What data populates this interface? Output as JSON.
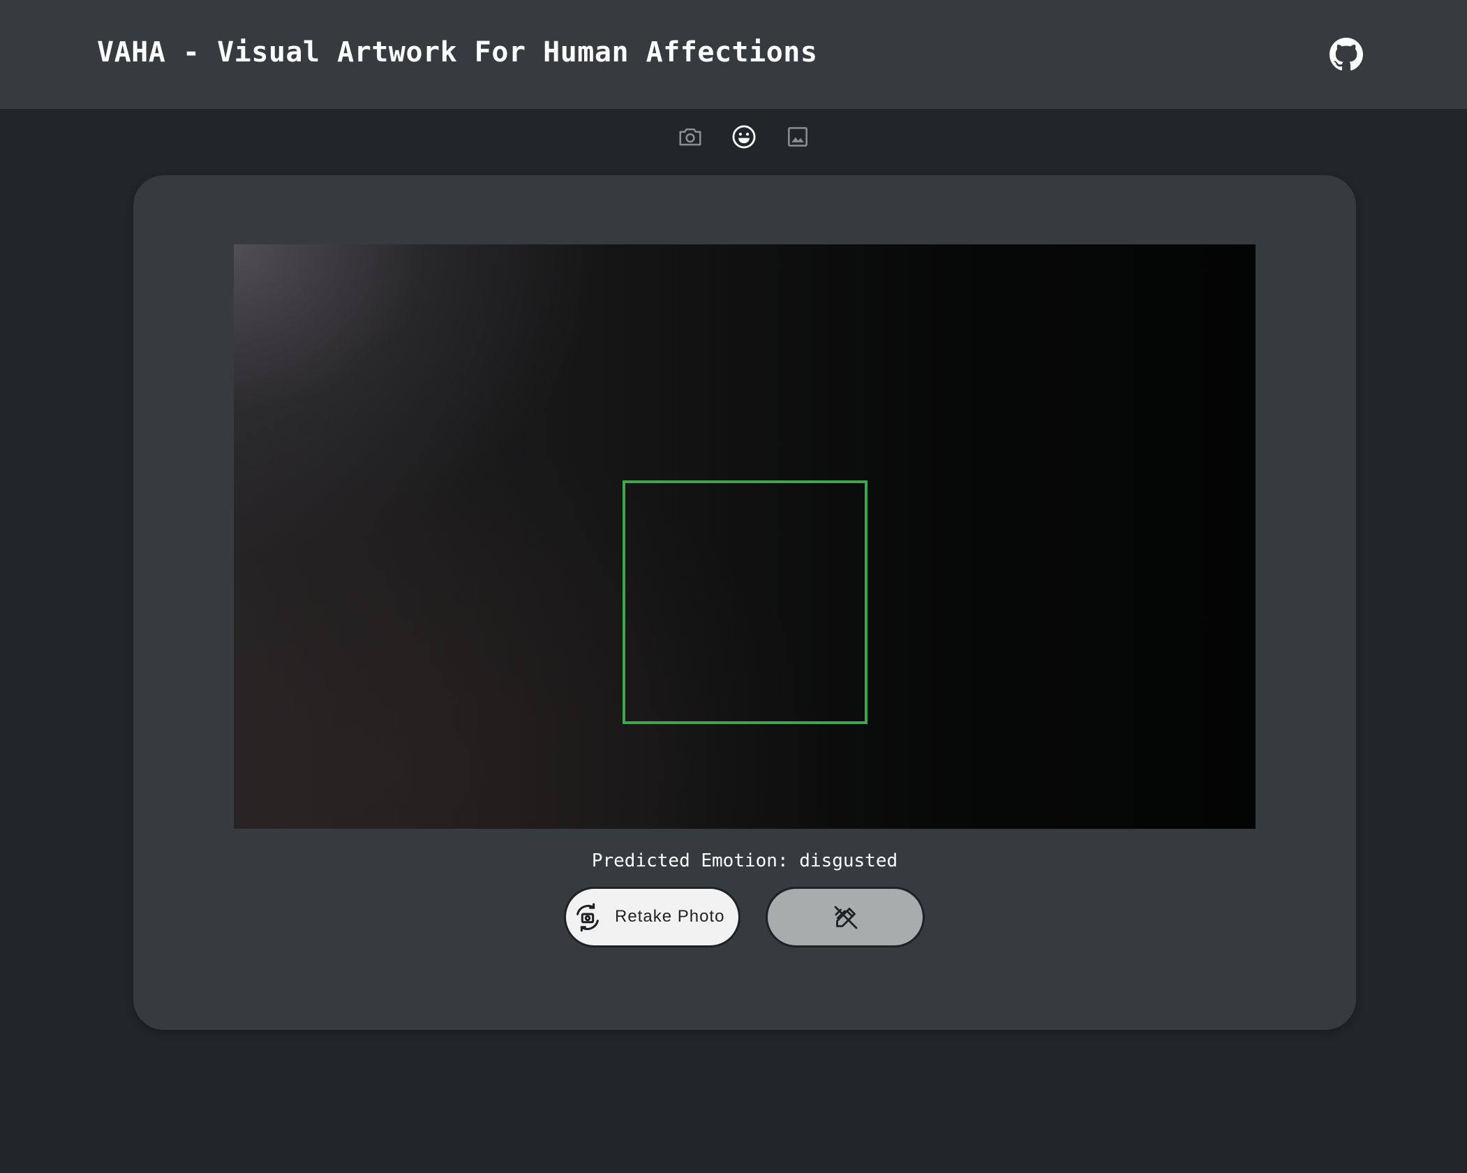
{
  "header": {
    "title": "VAHA - Visual Artwork For Human Affections",
    "github_icon": "github-icon"
  },
  "mode_tabs": [
    {
      "icon": "camera-icon",
      "active": false
    },
    {
      "icon": "smiley-face-icon",
      "active": true
    },
    {
      "icon": "image-icon",
      "active": false
    }
  ],
  "main": {
    "emotion_label": "Predicted Emotion: disgusted",
    "retake_button": {
      "label": "Retake Photo",
      "icon": "retake-camera-icon"
    },
    "draw_button": {
      "icon": "draw-pen-icon"
    },
    "face_box_color": "#3fa64a"
  },
  "colors": {
    "background": "#212629",
    "header": "#353b3e",
    "card": "#353b3e",
    "retake_button_bg": "#f2f2f2",
    "draw_button_bg": "#a8acad"
  }
}
